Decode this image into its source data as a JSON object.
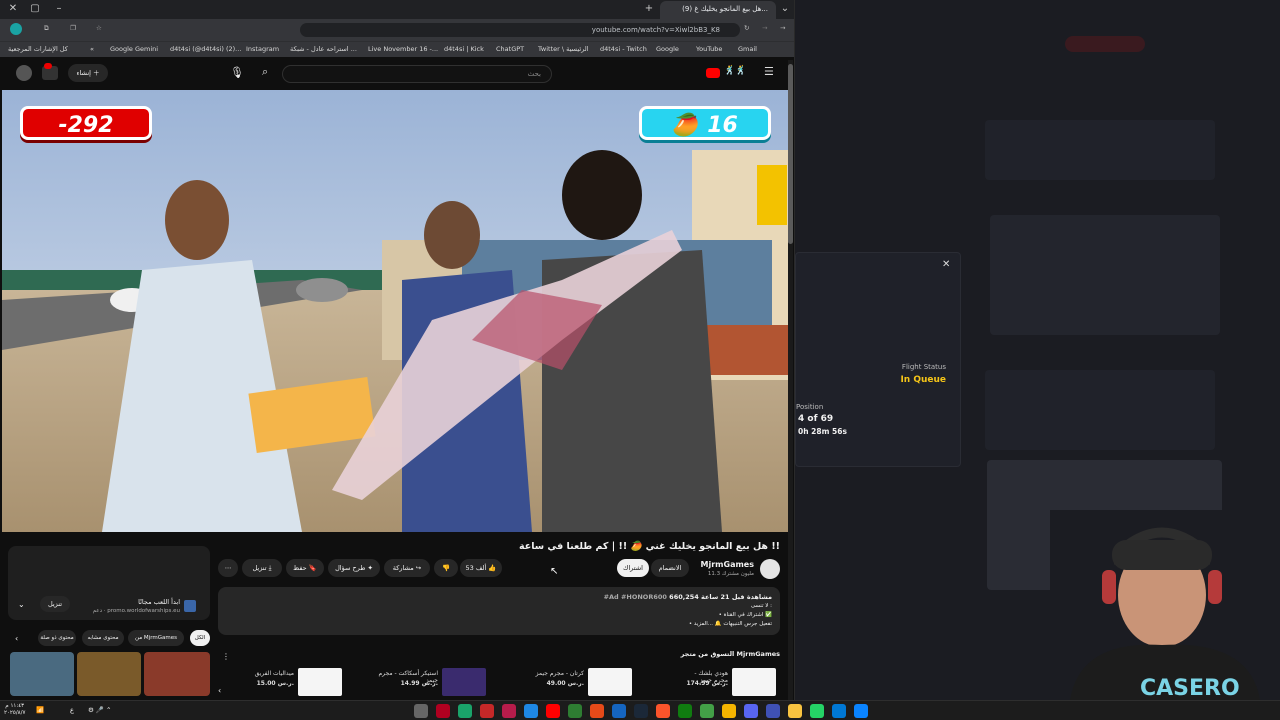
{
  "browser": {
    "tabs": [
      {
        "label": "(9) هل بيع المانجو يخليك غ..."
      }
    ],
    "url": "youtube.com/watch?v=Xiwl2bB3_K8",
    "bookmarks": [
      "Google Gemini",
      "d4t4si (@d4t4si) (2)...",
      "Instagram",
      "استراحه عادل - شبكة ...",
      "Live November 16 -...",
      "d4t4si | Kick",
      "ChatGPT",
      "Twitter \\ الرئيسية",
      "d4t4si - Twitch",
      "Google",
      "YouTube",
      "Gmail"
    ],
    "bookmarks_right": "كل الإشارات المرجعية"
  },
  "yt": {
    "create_label": "إنشاء",
    "search_placeholder": "بحث",
    "score_left": "-292",
    "score_right": "16",
    "video_title": "هل بيع المانجو يخليك غني 🥭 !! | كم طلعنا في ساعة !!",
    "channel_name": "MjrmGames",
    "subscribers": "11.3 مليون مشترك",
    "join_label": "الانضمام",
    "subscribed_label": "اشتراك",
    "likes": "53 ألف",
    "share_label": "مشاركة",
    "ask_label": "طرح سؤال",
    "save_label": "حفظ",
    "download_label": "تنزيل",
    "views_line": "660,254 مشاهدة قبل 21 ساعة",
    "hashtags": "#Ad #HONOR600",
    "desc_lines": [
      "لا تنسى :",
      "• اشتراك في القناة ✅",
      "• تفعيل جرس التنبيهات 🔔 ...المزيد"
    ],
    "shop_heading": "التسوق من متجر MjrmGames",
    "shop_items": [
      {
        "name": "هودي بلشك - مجرم جيمز",
        "price": "174.99 ر.س."
      },
      {
        "name": "كرتان - مجرم جيمز",
        "price": "49.00 ر.س."
      },
      {
        "name": "استيكر أسكاكت - مجرم جيمز",
        "price": "14.99 ر.س."
      },
      {
        "name": "ميداليات الفريق",
        "price": "15.00 ر.س."
      }
    ],
    "ad_title": "ابدأ اللعب مجانًا",
    "ad_sponsor": "دعم",
    "ad_domain": "promo.worldofwarships.eu",
    "ad_download": "تنزيل",
    "chips": [
      "الكل",
      "من MjrmGames",
      "محتوى مشابه",
      "محتوى ذو صلة"
    ]
  },
  "flight": {
    "status_label": "Flight Status",
    "status_value": "In Queue",
    "position_label": "Position",
    "position_value": "4 of 69",
    "eta": "0h 28m 56s"
  },
  "taskbar": {
    "time": "١١:٤٣ م",
    "date": "٢٠٢٥/٨/٧",
    "lang": "ع"
  },
  "colors": {
    "score_left": "#e00000",
    "score_right": "#28d4f0",
    "flight_status": "#f5c518"
  }
}
